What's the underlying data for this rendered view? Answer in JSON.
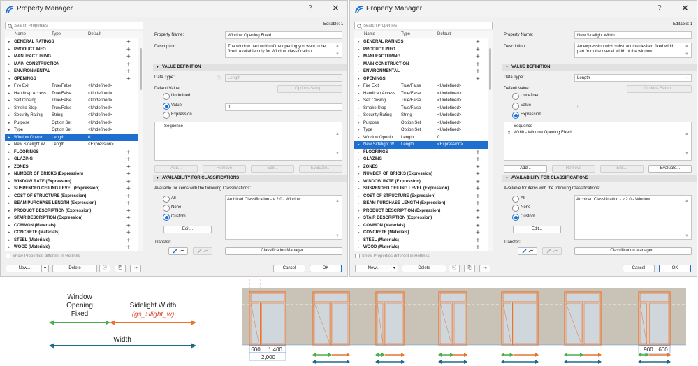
{
  "dialogs": [
    {
      "title": "Property Manager",
      "search_placeholder": "Search Properties",
      "columns": [
        "Name",
        "Type",
        "Default"
      ],
      "editable": "Editable: 1",
      "rows": [
        {
          "expand": "▸",
          "name": "GENERAL RATINGS",
          "type": "",
          "default": "",
          "group": true
        },
        {
          "expand": "▸",
          "name": "PRODUCT INFO",
          "type": "",
          "default": "",
          "group": true
        },
        {
          "expand": "▸",
          "name": "MANUFACTURING",
          "type": "",
          "default": "",
          "group": true
        },
        {
          "expand": "▸",
          "name": "MAIN CONSTRUCTION",
          "type": "",
          "default": "",
          "group": true
        },
        {
          "expand": "▸",
          "name": "ENVIRONMENTAL",
          "type": "",
          "default": "",
          "group": true
        },
        {
          "expand": "▾",
          "name": "OPENINGS",
          "type": "",
          "default": "",
          "group": true
        },
        {
          "expand": "▸",
          "name": "Fire Exit",
          "type": "True/False",
          "default": "<Undefined>",
          "group": false
        },
        {
          "expand": "▸",
          "name": "Handicap Access...",
          "type": "True/False",
          "default": "<Undefined>",
          "group": false
        },
        {
          "expand": "▸",
          "name": "Self Closing",
          "type": "True/False",
          "default": "<Undefined>",
          "group": false
        },
        {
          "expand": "▸",
          "name": "Smoke Stop",
          "type": "True/False",
          "default": "<Undefined>",
          "group": false
        },
        {
          "expand": "▸",
          "name": "Security Rating",
          "type": "String",
          "default": "<Undefined>",
          "group": false
        },
        {
          "expand": "▸",
          "name": "Purpose",
          "type": "Option Set",
          "default": "<Undefined>",
          "group": false
        },
        {
          "expand": "▸",
          "name": "Type",
          "type": "Option Set",
          "default": "<Undefined>",
          "group": false
        },
        {
          "expand": "▸",
          "name": "Window Openin...",
          "type": "Length",
          "default": "0",
          "group": false
        },
        {
          "expand": "▸",
          "name": "New Sidelight W...",
          "type": "Length",
          "default": "<Expression>",
          "group": false
        },
        {
          "expand": "▸",
          "name": "FLOORINGS",
          "type": "",
          "default": "",
          "group": true
        },
        {
          "expand": "▸",
          "name": "GLAZING",
          "type": "",
          "default": "",
          "group": true
        },
        {
          "expand": "▸",
          "name": "ZONES",
          "type": "",
          "default": "",
          "group": true
        },
        {
          "expand": "▸",
          "name": "NUMBER OF BRICKS (Expression)",
          "type": "",
          "default": "",
          "group": true
        },
        {
          "expand": "▸",
          "name": "WINDOW RATE (Expression)",
          "type": "",
          "default": "",
          "group": true
        },
        {
          "expand": "▸",
          "name": "SUSPENDED CEILING LEVEL (Expression)",
          "type": "",
          "default": "",
          "group": true
        },
        {
          "expand": "▸",
          "name": "COST OF STRUCTURE (Expression)",
          "type": "",
          "default": "",
          "group": true
        },
        {
          "expand": "▸",
          "name": "BEAM PURCHASE LENGTH (Expression)",
          "type": "",
          "default": "",
          "group": true
        },
        {
          "expand": "▸",
          "name": "PRODUCT DESCRIPTION (Expression)",
          "type": "",
          "default": "",
          "group": true
        },
        {
          "expand": "▸",
          "name": "STAIR DESCRIPTION (Expression)",
          "type": "",
          "default": "",
          "group": true
        },
        {
          "expand": "▸",
          "name": "COMMON (Materials)",
          "type": "",
          "default": "",
          "group": true
        },
        {
          "expand": "▸",
          "name": "CONCRETE (Materials)",
          "type": "",
          "default": "",
          "group": true
        },
        {
          "expand": "▸",
          "name": "STEEL (Materials)",
          "type": "",
          "default": "",
          "group": true
        },
        {
          "expand": "▸",
          "name": "WOOD (Materials)",
          "type": "",
          "default": "",
          "group": true
        }
      ],
      "selected_index": 13,
      "hotlinks_label": "Show Properties different in Hotlinks",
      "new_label": "New...",
      "delete_label": "Delete",
      "property_name_label": "Property Name:",
      "property_name": "Window Opening Fixed",
      "description_label": "Description:",
      "description": "The window part width of the opening you want to be fixed. Available only for Window classification.",
      "value_definition": "VALUE DEFINITION",
      "data_type_label": "Data Type:",
      "data_type": "Length",
      "default_value_label": "Default Value:",
      "options_setup": "Options Setup...",
      "radio_undefined": "Undefined",
      "radio_value": "Value",
      "radio_expression": "Expression",
      "selected_radio": "value",
      "value_field": "0",
      "sequence_label": "Sequence",
      "sequence_item": "",
      "add_label": "Add...",
      "remove_label": "Remove",
      "edit_label": "Edit...",
      "evaluate_label": "Evaluate...",
      "availability": "AVAILABILITY FOR CLASSIFICATIONS",
      "available_text": "Available for items with the following Classifications:",
      "radio_all": "All",
      "radio_none": "None",
      "radio_custom": "Custom",
      "classification": "Archicad Classification - v 2.0 - Window",
      "edit_class_label": "Edit...",
      "transfer_label": "Transfer:",
      "class_manager": "Classification Manager...",
      "cancel_label": "Cancel",
      "ok_label": "OK"
    },
    {
      "title": "Property Manager",
      "search_placeholder": "Search Properties",
      "columns": [
        "Name",
        "Type",
        "Default"
      ],
      "editable": "Editable: 1",
      "rows": [
        {
          "expand": "▸",
          "name": "GENERAL RATINGS",
          "type": "",
          "default": "",
          "group": true
        },
        {
          "expand": "▸",
          "name": "PRODUCT INFO",
          "type": "",
          "default": "",
          "group": true
        },
        {
          "expand": "▸",
          "name": "MANUFACTURING",
          "type": "",
          "default": "",
          "group": true
        },
        {
          "expand": "▸",
          "name": "MAIN CONSTRUCTION",
          "type": "",
          "default": "",
          "group": true
        },
        {
          "expand": "▸",
          "name": "ENVIRONMENTAL",
          "type": "",
          "default": "",
          "group": true
        },
        {
          "expand": "▾",
          "name": "OPENINGS",
          "type": "",
          "default": "",
          "group": true
        },
        {
          "expand": "▸",
          "name": "Fire Exit",
          "type": "True/False",
          "default": "<Undefined>",
          "group": false
        },
        {
          "expand": "▸",
          "name": "Handicap Access...",
          "type": "True/False",
          "default": "<Undefined>",
          "group": false
        },
        {
          "expand": "▸",
          "name": "Self Closing",
          "type": "True/False",
          "default": "<Undefined>",
          "group": false
        },
        {
          "expand": "▸",
          "name": "Smoke Stop",
          "type": "True/False",
          "default": "<Undefined>",
          "group": false
        },
        {
          "expand": "▸",
          "name": "Security Rating",
          "type": "String",
          "default": "<Undefined>",
          "group": false
        },
        {
          "expand": "▸",
          "name": "Purpose",
          "type": "Option Set",
          "default": "<Undefined>",
          "group": false
        },
        {
          "expand": "▸",
          "name": "Type",
          "type": "Option Set",
          "default": "<Undefined>",
          "group": false
        },
        {
          "expand": "▸",
          "name": "Window Openin...",
          "type": "Length",
          "default": "0",
          "group": false
        },
        {
          "expand": "▸",
          "name": "New Sidelight W...",
          "type": "Length",
          "default": "<Expression>",
          "group": false
        },
        {
          "expand": "▸",
          "name": "FLOORINGS",
          "type": "",
          "default": "",
          "group": true
        },
        {
          "expand": "▸",
          "name": "GLAZING",
          "type": "",
          "default": "",
          "group": true
        },
        {
          "expand": "▸",
          "name": "ZONES",
          "type": "",
          "default": "",
          "group": true
        },
        {
          "expand": "▸",
          "name": "NUMBER OF BRICKS (Expression)",
          "type": "",
          "default": "",
          "group": true
        },
        {
          "expand": "▸",
          "name": "WINDOW RATE (Expression)",
          "type": "",
          "default": "",
          "group": true
        },
        {
          "expand": "▸",
          "name": "SUSPENDED CEILING LEVEL (Expression)",
          "type": "",
          "default": "",
          "group": true
        },
        {
          "expand": "▸",
          "name": "COST OF STRUCTURE (Expression)",
          "type": "",
          "default": "",
          "group": true
        },
        {
          "expand": "▸",
          "name": "BEAM PURCHASE LENGTH (Expression)",
          "type": "",
          "default": "",
          "group": true
        },
        {
          "expand": "▸",
          "name": "PRODUCT DESCRIPTION (Expression)",
          "type": "",
          "default": "",
          "group": true
        },
        {
          "expand": "▸",
          "name": "STAIR DESCRIPTION (Expression)",
          "type": "",
          "default": "",
          "group": true
        },
        {
          "expand": "▸",
          "name": "COMMON (Materials)",
          "type": "",
          "default": "",
          "group": true
        },
        {
          "expand": "▸",
          "name": "CONCRETE (Materials)",
          "type": "",
          "default": "",
          "group": true
        },
        {
          "expand": "▸",
          "name": "STEEL (Materials)",
          "type": "",
          "default": "",
          "group": true
        },
        {
          "expand": "▸",
          "name": "WOOD (Materials)",
          "type": "",
          "default": "",
          "group": true
        }
      ],
      "selected_index": 14,
      "hotlinks_label": "Show Properties different in Hotlinks",
      "new_label": "New...",
      "delete_label": "Delete",
      "property_name_label": "Property Name:",
      "property_name": "New Sidelight Width",
      "description_label": "Description:",
      "description": "An expression wich substract the desired fixed width part from the overall width of the window.",
      "value_definition": "VALUE DEFINITION",
      "data_type_label": "Data Type:",
      "data_type": "Length",
      "default_value_label": "Default Value:",
      "options_setup": "Options Setup...",
      "radio_undefined": "Undefined",
      "radio_value": "Value",
      "radio_expression": "Expression",
      "selected_radio": "expression",
      "value_field": "0",
      "sequence_label": "Sequence",
      "sequence_item": "Width - Window Opening Fixed",
      "add_label": "Add...",
      "remove_label": "Remove",
      "edit_label": "Edit...",
      "evaluate_label": "Evaluate...",
      "availability": "AVAILABILITY FOR CLASSIFICATIONS",
      "available_text": "Available for items with the following Classifications:",
      "radio_all": "All",
      "radio_none": "None",
      "radio_custom": "Custom",
      "classification": "Archicad Classification - v 2.0 - Window",
      "edit_class_label": "Edit...",
      "transfer_label": "Transfer:",
      "class_manager": "Classification Manager...",
      "cancel_label": "Cancel",
      "ok_label": "OK"
    }
  ],
  "diagram": {
    "window_label": "Window Opening Fixed",
    "sidelight_label": "Sidelight Width",
    "sidelight_param": "(gs_Slight_w)",
    "width_label": "Width",
    "dim_600": "600",
    "dim_1400": "1,400",
    "dim_2000": "2,000",
    "dim_900": "900",
    "dim_600b": "600",
    "colors": {
      "green": "#4cae4c",
      "orange": "#e8742f",
      "blue": "#1f6a8c",
      "red": "#d9472b",
      "wall": "#c9c2b6"
    }
  }
}
